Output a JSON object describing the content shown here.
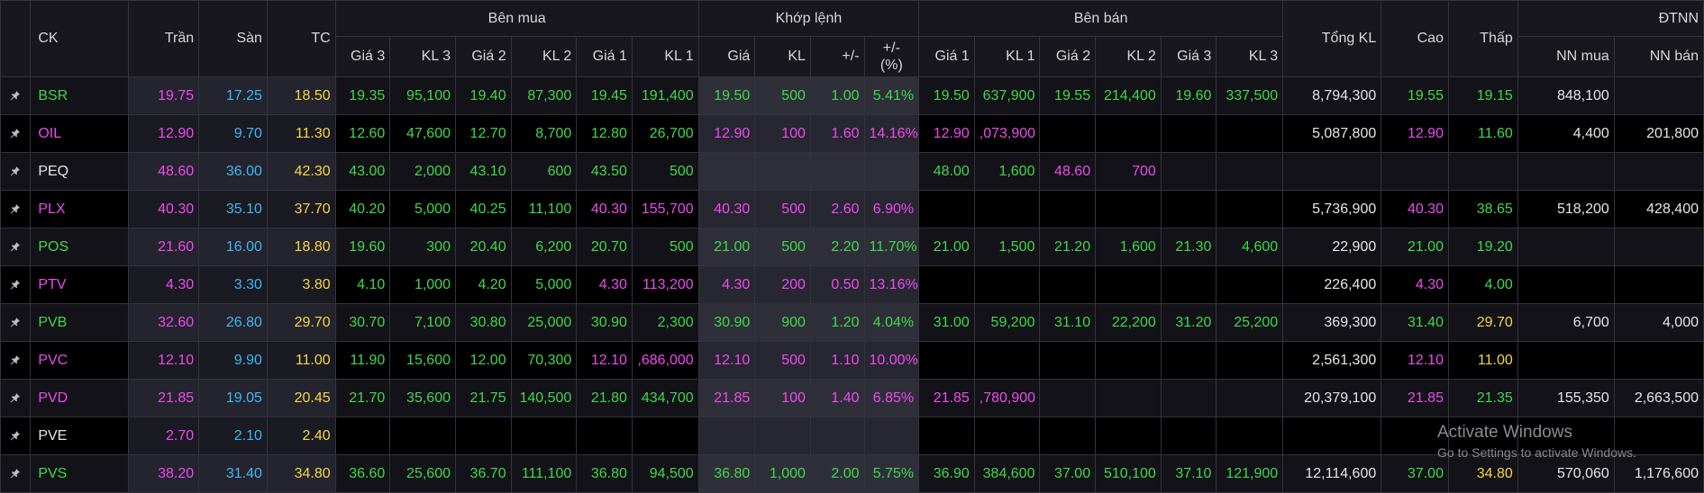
{
  "header": {
    "ck": "CK",
    "tran": "Trần",
    "san": "Sàn",
    "tc": "TC",
    "ben_mua": "Bên mua",
    "khop_lenh": "Khớp lệnh",
    "ben_ban": "Bên bán",
    "tong_kl": "Tổng KL",
    "cao": "Cao",
    "thap": "Thấp",
    "dtnn": "ĐTNN",
    "gia3": "Giá 3",
    "kl3": "KL 3",
    "gia2": "Giá 2",
    "kl2": "KL 2",
    "gia1": "Giá 1",
    "kl1": "KL 1",
    "gia": "Giá",
    "kl": "KL",
    "change": "+/-",
    "change_pct": "+/-\n(%)",
    "nn_mua": "NN mua",
    "nn_ban": "NN bán"
  },
  "colors": {
    "ceiling": "#ef49ef",
    "floor": "#3fb8f2",
    "reference": "#f5d742",
    "up": "#3fd94a",
    "down": "#f2414d",
    "neutral": "#e6e6e6"
  },
  "rows": [
    {
      "sym": "BSR",
      "tran": "19.75",
      "san": "17.25",
      "tc": "18.50",
      "b3p": "19.35",
      "b3v": "95,100",
      "b2p": "19.40",
      "b2v": "87,300",
      "b1p": "19.45",
      "b1v": "191,400",
      "mp": "19.50",
      "mv": "500",
      "chg": "1.00",
      "pct": "5.41%",
      "s1p": "19.50",
      "s1v": "637,900",
      "s2p": "19.55",
      "s2v": "214,400",
      "s3p": "19.60",
      "s3v": "337,500",
      "tkl": "8,794,300",
      "cao": "19.55",
      "thap": "19.15",
      "nnm": "848,100",
      "nnb": ""
    },
    {
      "sym": "OIL",
      "tran": "12.90",
      "san": "9.70",
      "tc": "11.30",
      "b3p": "12.60",
      "b3v": "47,600",
      "b2p": "12.70",
      "b2v": "8,700",
      "b1p": "12.80",
      "b1v": "26,700",
      "mp": "12.90",
      "mv": "100",
      "chg": "1.60",
      "pct": "14.16%",
      "s1p": "12.90",
      "s1v": ",073,900",
      "s2p": "",
      "s2v": "",
      "s3p": "",
      "s3v": "",
      "tkl": "5,087,800",
      "cao": "12.90",
      "thap": "11.60",
      "nnm": "4,400",
      "nnb": "201,800"
    },
    {
      "sym": "PEQ",
      "tran": "48.60",
      "san": "36.00",
      "tc": "42.30",
      "b3p": "43.00",
      "b3v": "2,000",
      "b2p": "43.10",
      "b2v": "600",
      "b1p": "43.50",
      "b1v": "500",
      "mp": "",
      "mv": "",
      "chg": "",
      "pct": "",
      "s1p": "48.00",
      "s1v": "1,600",
      "s2p": "48.60",
      "s2v": "700",
      "s3p": "",
      "s3v": "",
      "tkl": "",
      "cao": "",
      "thap": "",
      "nnm": "",
      "nnb": ""
    },
    {
      "sym": "PLX",
      "tran": "40.30",
      "san": "35.10",
      "tc": "37.70",
      "b3p": "40.20",
      "b3v": "5,000",
      "b2p": "40.25",
      "b2v": "11,100",
      "b1p": "40.30",
      "b1v": "155,700",
      "mp": "40.30",
      "mv": "500",
      "chg": "2.60",
      "pct": "6.90%",
      "s1p": "",
      "s1v": "",
      "s2p": "",
      "s2v": "",
      "s3p": "",
      "s3v": "",
      "tkl": "5,736,900",
      "cao": "40.30",
      "thap": "38.65",
      "nnm": "518,200",
      "nnb": "428,400"
    },
    {
      "sym": "POS",
      "tran": "21.60",
      "san": "16.00",
      "tc": "18.80",
      "b3p": "19.60",
      "b3v": "300",
      "b2p": "20.40",
      "b2v": "6,200",
      "b1p": "20.70",
      "b1v": "500",
      "mp": "21.00",
      "mv": "500",
      "chg": "2.20",
      "pct": "11.70%",
      "s1p": "21.00",
      "s1v": "1,500",
      "s2p": "21.20",
      "s2v": "1,600",
      "s3p": "21.30",
      "s3v": "4,600",
      "tkl": "22,900",
      "cao": "21.00",
      "thap": "19.20",
      "nnm": "",
      "nnb": ""
    },
    {
      "sym": "PTV",
      "tran": "4.30",
      "san": "3.30",
      "tc": "3.80",
      "b3p": "4.10",
      "b3v": "1,000",
      "b2p": "4.20",
      "b2v": "5,000",
      "b1p": "4.30",
      "b1v": "113,200",
      "mp": "4.30",
      "mv": "200",
      "chg": "0.50",
      "pct": "13.16%",
      "s1p": "",
      "s1v": "",
      "s2p": "",
      "s2v": "",
      "s3p": "",
      "s3v": "",
      "tkl": "226,400",
      "cao": "4.30",
      "thap": "4.00",
      "nnm": "",
      "nnb": ""
    },
    {
      "sym": "PVB",
      "tran": "32.60",
      "san": "26.80",
      "tc": "29.70",
      "b3p": "30.70",
      "b3v": "7,100",
      "b2p": "30.80",
      "b2v": "25,000",
      "b1p": "30.90",
      "b1v": "2,300",
      "mp": "30.90",
      "mv": "900",
      "chg": "1.20",
      "pct": "4.04%",
      "s1p": "31.00",
      "s1v": "59,200",
      "s2p": "31.10",
      "s2v": "22,200",
      "s3p": "31.20",
      "s3v": "25,200",
      "tkl": "369,300",
      "cao": "31.40",
      "thap": "29.70",
      "nnm": "6,700",
      "nnb": "4,000"
    },
    {
      "sym": "PVC",
      "tran": "12.10",
      "san": "9.90",
      "tc": "11.00",
      "b3p": "11.90",
      "b3v": "15,600",
      "b2p": "12.00",
      "b2v": "70,300",
      "b1p": "12.10",
      "b1v": ",686,000",
      "mp": "12.10",
      "mv": "500",
      "chg": "1.10",
      "pct": "10.00%",
      "s1p": "",
      "s1v": "",
      "s2p": "",
      "s2v": "",
      "s3p": "",
      "s3v": "",
      "tkl": "2,561,300",
      "cao": "12.10",
      "thap": "11.00",
      "nnm": "",
      "nnb": ""
    },
    {
      "sym": "PVD",
      "tran": "21.85",
      "san": "19.05",
      "tc": "20.45",
      "b3p": "21.70",
      "b3v": "35,600",
      "b2p": "21.75",
      "b2v": "140,500",
      "b1p": "21.80",
      "b1v": "434,700",
      "mp": "21.85",
      "mv": "100",
      "chg": "1.40",
      "pct": "6.85%",
      "s1p": "21.85",
      "s1v": ",780,900",
      "s2p": "",
      "s2v": "",
      "s3p": "",
      "s3v": "",
      "tkl": "20,379,100",
      "cao": "21.85",
      "thap": "21.35",
      "nnm": "155,350",
      "nnb": "2,663,500"
    },
    {
      "sym": "PVE",
      "tran": "2.70",
      "san": "2.10",
      "tc": "2.40",
      "b3p": "",
      "b3v": "",
      "b2p": "",
      "b2v": "",
      "b1p": "",
      "b1v": "",
      "mp": "",
      "mv": "",
      "chg": "",
      "pct": "",
      "s1p": "",
      "s1v": "",
      "s2p": "",
      "s2v": "",
      "s3p": "",
      "s3v": "",
      "tkl": "",
      "cao": "",
      "thap": "",
      "nnm": "",
      "nnb": ""
    },
    {
      "sym": "PVS",
      "tran": "38.20",
      "san": "31.40",
      "tc": "34.80",
      "b3p": "36.60",
      "b3v": "25,600",
      "b2p": "36.70",
      "b2v": "111,100",
      "b1p": "36.80",
      "b1v": "94,500",
      "mp": "36.80",
      "mv": "1,000",
      "chg": "2.00",
      "pct": "5.75%",
      "s1p": "36.90",
      "s1v": "384,600",
      "s2p": "37.00",
      "s2v": "510,100",
      "s3p": "37.10",
      "s3v": "121,900",
      "tkl": "12,114,600",
      "cao": "37.00",
      "thap": "34.80",
      "nnm": "570,060",
      "nnb": "1,176,600"
    }
  ],
  "watermark": {
    "title": "Activate Windows",
    "subtitle": "Go to Settings to activate Windows."
  }
}
